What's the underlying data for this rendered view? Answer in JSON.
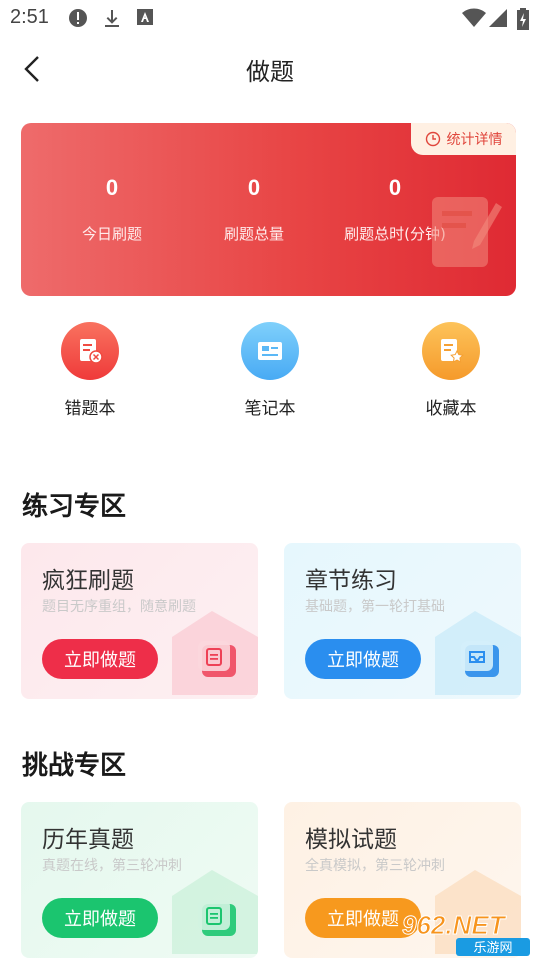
{
  "status_bar": {
    "time": "2:51"
  },
  "nav": {
    "title": "做题"
  },
  "stats": {
    "detail_label": "统计详情",
    "items": [
      {
        "value": "0",
        "label": "今日刷题"
      },
      {
        "value": "0",
        "label": "刷题总量"
      },
      {
        "value": "0",
        "label": "刷题总时(分钟)"
      }
    ]
  },
  "shortcuts": [
    {
      "label": "错题本",
      "color": "#f0443b"
    },
    {
      "label": "笔记本",
      "color": "#5bb8f6"
    },
    {
      "label": "收藏本",
      "color": "#f7a53a"
    }
  ],
  "practice_section": {
    "title": "练习专区",
    "cards": [
      {
        "title": "疯狂刷题",
        "subtitle": "题目无序重组，随意刷题",
        "button": "立即做题",
        "accent": "#ee2e49"
      },
      {
        "title": "章节练习",
        "subtitle": "基础题，第一轮打基础",
        "button": "立即做题",
        "accent": "#2a8eef"
      }
    ]
  },
  "challenge_section": {
    "title": "挑战专区",
    "cards": [
      {
        "title": "历年真题",
        "subtitle": "真题在线，第三轮冲刺",
        "button": "立即做题",
        "accent": "#1bc56f"
      },
      {
        "title": "模拟试题",
        "subtitle": "全真模拟，第三轮冲刺",
        "button": "立即做题",
        "accent": "#f7991e"
      }
    ]
  },
  "watermark": {
    "brand": "962.NET",
    "sub": "乐游网"
  }
}
